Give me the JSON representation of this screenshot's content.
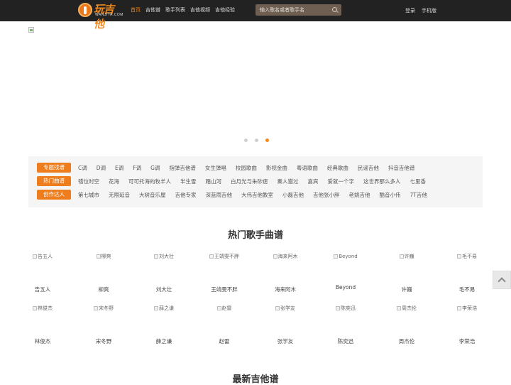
{
  "header": {
    "logo_text": "玩吉他",
    "logo_sub": "WANJITA.COM",
    "nav": [
      "首页",
      "吉他谱",
      "歌手列表",
      "吉他视频",
      "吉他经验"
    ],
    "search_placeholder": "输入歌名或者歌手名",
    "login": "登录",
    "mobile": "手机版"
  },
  "banner": {
    "dots": 3,
    "active_dot": 3
  },
  "tags": {
    "rows": [
      {
        "label": "专题找谱",
        "items": [
          "C调",
          "D调",
          "E调",
          "F调",
          "G调",
          "指弹吉他谱",
          "女生弹唱",
          "校园歌曲",
          "影视金曲",
          "粤语歌曲",
          "经典歌曲",
          "民谣吉他",
          "抖音吉他谱"
        ]
      },
      {
        "label": "热门曲谱",
        "items": [
          "错位时空",
          "花海",
          "可可托海的牧羊人",
          "半生雪",
          "踏山河",
          "白月光与朱砂痣",
          "秦人猎过",
          "嘉宾",
          "爱就一个字",
          "这世界那么多人",
          "七里香"
        ]
      },
      {
        "label": "创作达人",
        "items": [
          "第七城市",
          "无限延音",
          "大树音乐屋",
          "吉他专家",
          "深蓝雨吉他",
          "大伟吉他教室",
          "小磊吉他",
          "吉他张小胖",
          "老姚吉他",
          "酷音小伟",
          "7T吉他"
        ]
      }
    ]
  },
  "hot_singers": {
    "title": "热门歌手曲谱",
    "row1": [
      {
        "alt": "告五人",
        "name": "告五人"
      },
      {
        "alt": "柳爽",
        "name": "柳爽"
      },
      {
        "alt": "刘大壮",
        "name": "刘大壮"
      },
      {
        "alt": "王靖雯不胖",
        "name": "王靖雯不胖"
      },
      {
        "alt": "海来阿木",
        "name": "海来阿木"
      },
      {
        "alt": "Beyond",
        "name": "Beyond"
      },
      {
        "alt": "许巍",
        "name": "许巍"
      },
      {
        "alt": "毛不易",
        "name": "毛不易"
      }
    ],
    "row2": [
      {
        "alt": "林俊杰",
        "name": "林俊杰"
      },
      {
        "alt": "宋冬野",
        "name": "宋冬野"
      },
      {
        "alt": "薛之谦",
        "name": "薛之谦"
      },
      {
        "alt": "赵雷",
        "name": "赵雷"
      },
      {
        "alt": "张学友",
        "name": "张学友"
      },
      {
        "alt": "陈奕迅",
        "name": "陈奕迅"
      },
      {
        "alt": "周杰伦",
        "name": "周杰伦"
      },
      {
        "alt": "李荣浩",
        "name": "李荣浩"
      }
    ]
  },
  "latest": {
    "title": "最新吉他谱"
  },
  "colors": {
    "accent": "#ee7d1e",
    "header_bg": "#222222",
    "panel_bg": "#f5f5f5"
  }
}
